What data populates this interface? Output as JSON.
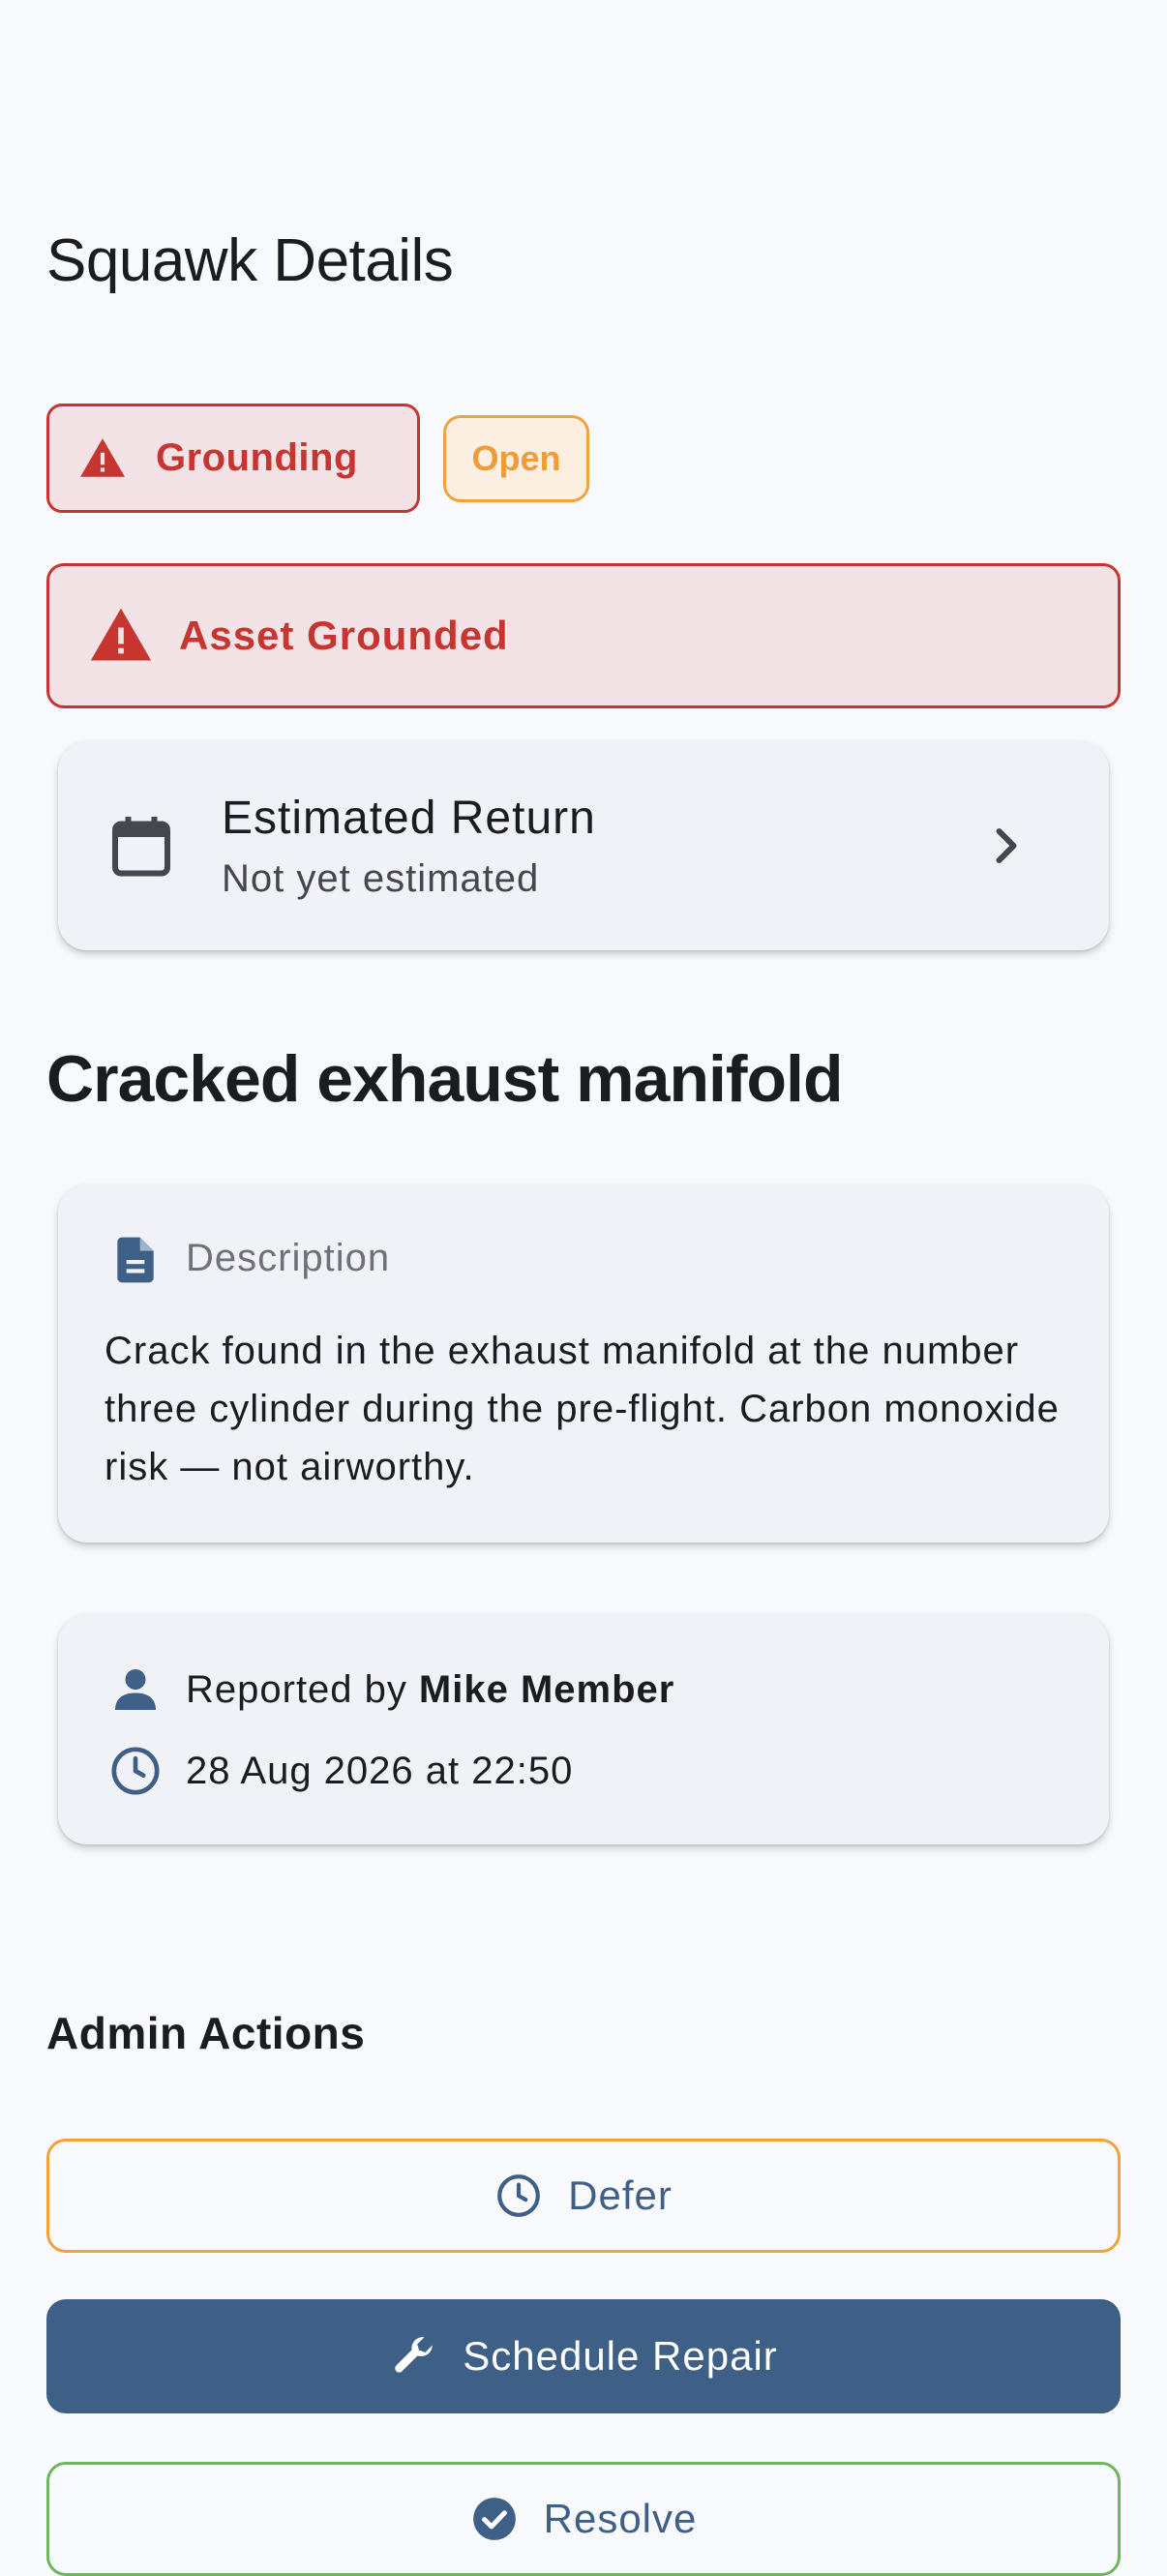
{
  "header": {
    "title": "Squawk Details"
  },
  "chips": {
    "grounding_label": "Grounding",
    "status_label": "Open"
  },
  "banner": {
    "label": "Asset Grounded"
  },
  "estimated_return": {
    "title": "Estimated Return",
    "value": "Not yet estimated"
  },
  "squawk": {
    "title": "Cracked exhaust manifold"
  },
  "description": {
    "label": "Description",
    "text": "Crack found in the exhaust manifold at the number three cylinder during the pre-flight. Carbon monoxide risk — not airworthy."
  },
  "meta": {
    "reported_prefix": "Reported by",
    "reporter": "Mike Member",
    "timestamp": "28 Aug 2026 at 22:50"
  },
  "admin": {
    "title": "Admin Actions",
    "defer_label": "Defer",
    "repair_label": "Schedule Repair",
    "resolve_label": "Resolve"
  },
  "colors": {
    "danger": "#c73530",
    "danger_bg": "#f4e3e6",
    "warning": "#f2a23a",
    "primary": "#3e5f86",
    "success": "#6cb75a",
    "background": "#f8f9fd",
    "card": "#f1f2f7"
  },
  "icons": {
    "grounding_chip": "warning-triangle-icon",
    "banner": "warning-triangle-icon",
    "estimated_return": "calendar-icon",
    "estimated_return_action": "chevron-right-icon",
    "description": "document-icon",
    "reporter": "person-icon",
    "timestamp": "clock-icon",
    "defer": "clock-icon",
    "repair": "wrench-icon",
    "resolve": "check-circle-icon"
  }
}
